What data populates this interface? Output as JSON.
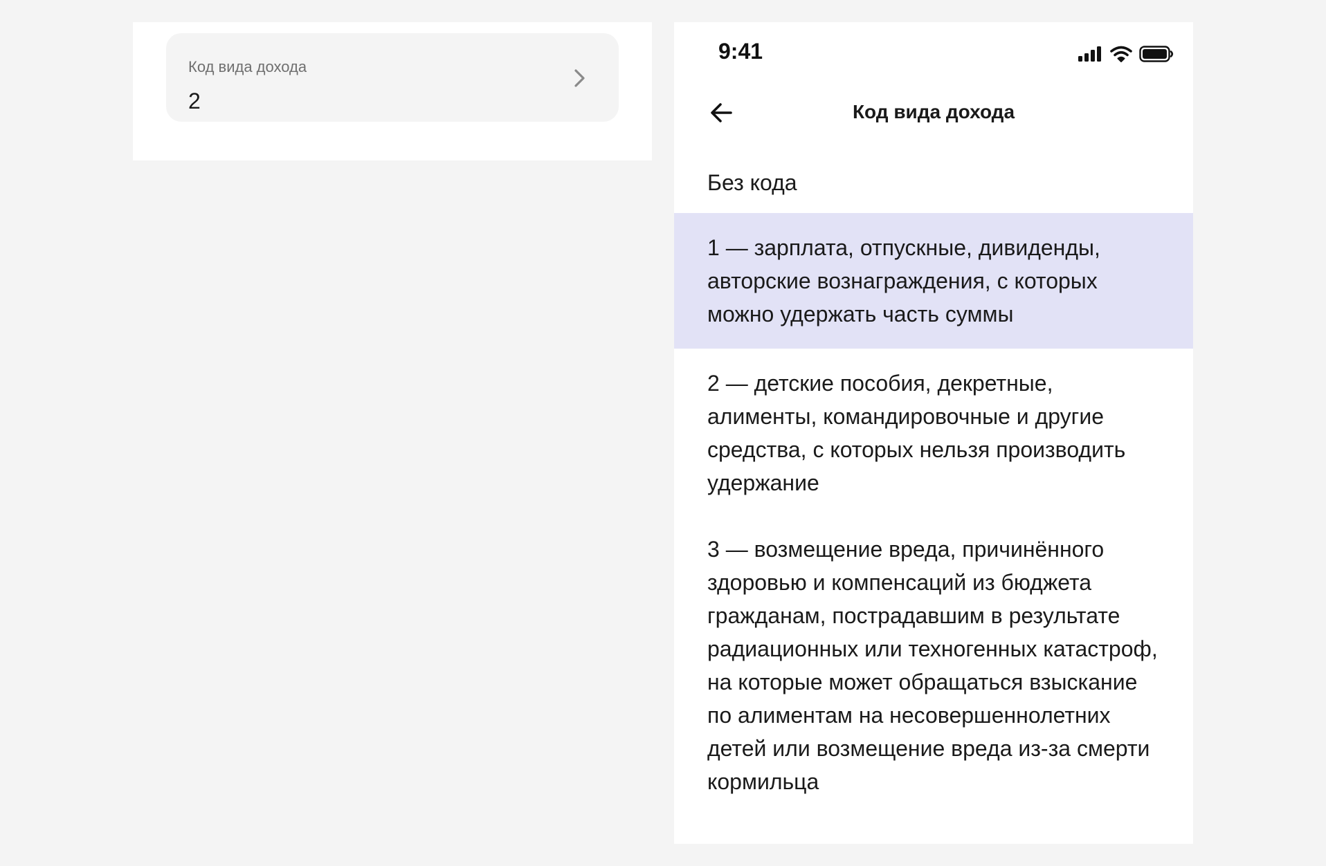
{
  "left_field": {
    "label": "Код вида дохода",
    "value": "2"
  },
  "status_bar": {
    "time": "9:41"
  },
  "nav": {
    "title": "Код вида дохода"
  },
  "options": [
    "Без кода",
    "1 — зарплата, отпускные, дивиденды, авторские вознаграждения, с которых можно удержать часть суммы",
    "2 — детские пособия, декретные, алименты, командировочные и другие средства, с которых нельзя производить удержание",
    "3 — возмещение вреда, причинённого здоровью и компенсаций из бюджета гражданам, пострадавшим в результате радиационных или техногенных катастроф, на которые может обращаться взыскание по алиментам на несовершеннолетних детей или возмещение вреда из-за смерти кормильца"
  ],
  "selected_option_index": 1,
  "colors": {
    "page_background": "#f4f4f4",
    "panel_background": "#ffffff",
    "field_background": "#f4f4f4",
    "selected_background": "#e2e2f6",
    "text_primary": "#1a1a1a",
    "text_secondary": "#6f6f6f"
  },
  "icons": {
    "field_chevron": "chevron-right-icon",
    "back": "arrow-left-icon",
    "signal": "cellular-signal-icon",
    "wifi": "wifi-icon",
    "battery": "battery-icon"
  }
}
